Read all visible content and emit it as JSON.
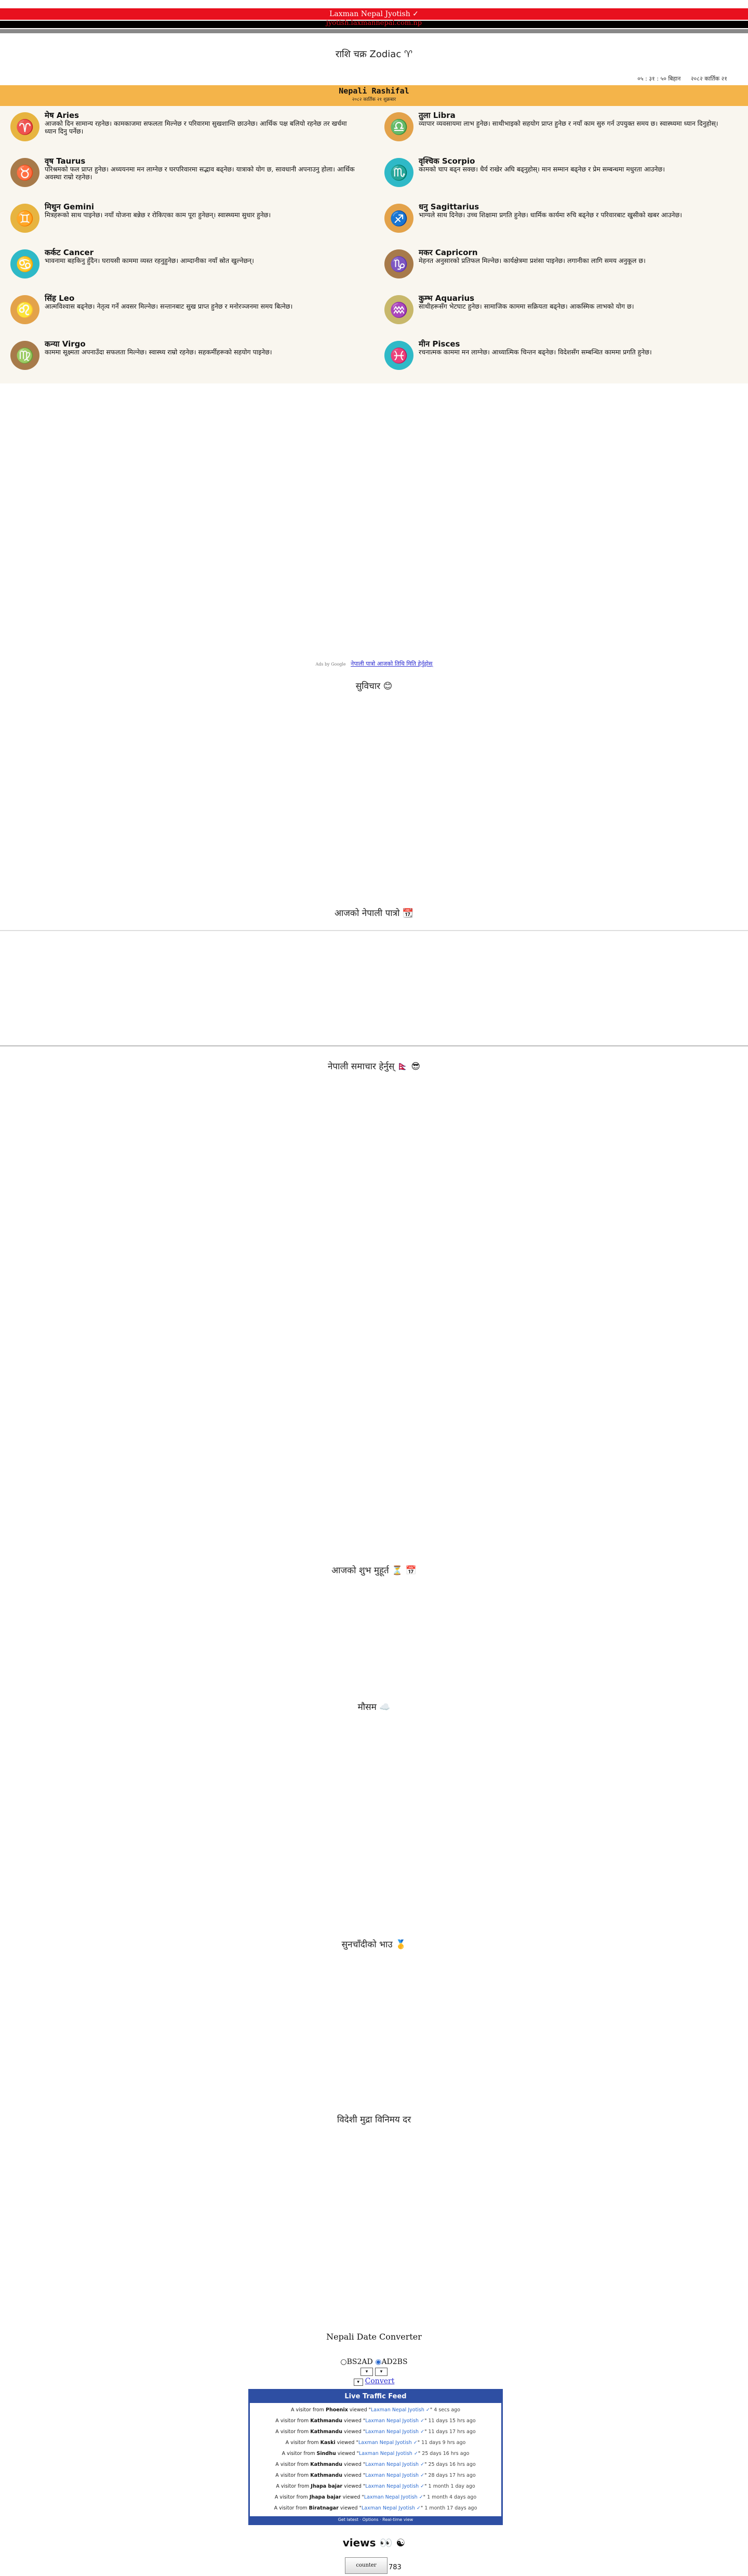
{
  "header": {
    "site_title": "Laxman Nepal Jyotish ✓",
    "site_domain": "jyotish.laxmannepal.com.np"
  },
  "zodiac_heading": "राशि चक्र Zodiac ♈",
  "date_line": {
    "time": "०५ : ३१ : ५० बिहान",
    "date": "२०८२ कार्तिक २१"
  },
  "rashifal": {
    "title": "Nepali Rashifal",
    "subtitle": "२०८२ कार्तिक २१ शुक्रबार",
    "signs": [
      {
        "name": "मेष Aries",
        "icon": "aries-icon",
        "glyph": "♈",
        "text": "आजको दिन सामान्य रहनेछ। कामकाजमा सफलता मिल्नेछ र परिवारमा सुखशान्ति छाउनेछ। आर्थिक पक्ष बलियो रहनेछ तर खर्चमा ध्यान दिनु पर्नेछ।"
      },
      {
        "name": "तुला Libra",
        "icon": "libra-icon",
        "glyph": "♎",
        "text": "व्यापार व्यवसायमा लाभ हुनेछ। साथीभाइको सहयोग प्राप्त हुनेछ र नयाँ काम सुरु गर्न उपयुक्त समय छ। स्वास्थ्यमा ध्यान दिनुहोस्।"
      },
      {
        "name": "वृष Taurus",
        "icon": "taurus-icon",
        "glyph": "♉",
        "text": "परिश्रमको फल प्राप्त हुनेछ। अध्ययनमा मन लाग्नेछ र घरपरिवारमा सद्भाव बढ्नेछ। यात्राको योग छ, सावधानी अपनाउनु होला। आर्थिक अवस्था राम्रो रहनेछ।"
      },
      {
        "name": "वृश्चिक Scorpio",
        "icon": "scorpio-icon",
        "glyph": "♏",
        "text": "कामको चाप बढ्न सक्छ। धैर्य राखेर अघि बढ्नुहोस्। मान सम्मान बढ्नेछ र प्रेम सम्बन्धमा मधुरता आउनेछ।"
      },
      {
        "name": "मिथुन Gemini",
        "icon": "gemini-icon",
        "glyph": "♊",
        "text": "मित्रहरूको साथ पाइनेछ। नयाँ योजना बन्नेछ र रोकिएका काम पूरा हुनेछन्। स्वास्थ्यमा सुधार हुनेछ।"
      },
      {
        "name": "धनु Sagittarius",
        "icon": "sagittarius-icon",
        "glyph": "♐",
        "text": "भाग्यले साथ दिनेछ। उच्च शिक्षामा प्रगति हुनेछ। धार्मिक कार्यमा रुचि बढ्नेछ र परिवारबाट खुसीको खबर आउनेछ।"
      },
      {
        "name": "कर्कट Cancer",
        "icon": "cancer-icon",
        "glyph": "♋",
        "text": "भावनामा बहकिनु हुँदैन। घरायसी काममा व्यस्त रहनुहुनेछ। आम्दानीका नयाँ स्रोत खुल्नेछन्।"
      },
      {
        "name": "मकर Capricorn",
        "icon": "capricorn-icon",
        "glyph": "♑",
        "text": "मेहनत अनुसारको प्रतिफल मिल्नेछ। कार्यक्षेत्रमा प्रशंसा पाइनेछ। लगानीका लागि समय अनुकूल छ।"
      },
      {
        "name": "सिंह Leo",
        "icon": "leo-icon",
        "glyph": "♌",
        "text": "आत्मविश्वास बढ्नेछ। नेतृत्व गर्ने अवसर मिल्नेछ। सन्तानबाट सुख प्राप्त हुनेछ र मनोरञ्जनमा समय बित्नेछ।"
      },
      {
        "name": "कुम्भ Aquarius",
        "icon": "aquarius-icon",
        "glyph": "♒",
        "text": "साथीहरूसँग भेटघाट हुनेछ। सामाजिक काममा सक्रियता बढ्नेछ। आकस्मिक लाभको योग छ।"
      },
      {
        "name": "कन्या Virgo",
        "icon": "virgo-icon",
        "glyph": "♍",
        "text": "काममा सूक्ष्मता अपनाउँदा सफलता मिल्नेछ। स्वास्थ्य राम्रो रहनेछ। सहकर्मीहरूको सहयोग पाइनेछ।"
      },
      {
        "name": "मीन Pisces",
        "icon": "pisces-icon",
        "glyph": "♓",
        "text": "रचनात्मक काममा मन लाग्नेछ। आध्यात्मिक चिन्तन बढ्नेछ। विदेशसँग सम्बन्धित काममा प्रगति हुनेछ।"
      }
    ]
  },
  "ad_link": {
    "label": "Ads by Google",
    "text": "नेपाली पात्रो आजको तिथि मिति हेर्नुहोस्"
  },
  "sections": {
    "s1": "सुविचार 😊",
    "s2": "आजको नेपाली पात्रो 📆",
    "s3": "नेपाली समाचार हेर्नुस् 🇳🇵 😎",
    "s4": "आजको शुभ मुहूर्त ⏳ 📅",
    "s5": "मौसम ☁️",
    "s6": "सुनचाँदीको भाउ 🥇",
    "s7": "विदेशी मुद्रा विनिमय दर"
  },
  "converter": {
    "title": "Nepali Date Converter",
    "opt_bs": "BS2AD",
    "opt_ad": "AD2BS",
    "button": "Convert"
  },
  "feed": {
    "title": "Live Traffic Feed",
    "rows": [
      {
        "city": "Phoenix",
        "page": "Laxman Nepal Jyotish ✓",
        "time": "4 secs ago"
      },
      {
        "city": "Kathmandu",
        "page": "Laxman Nepal Jyotish ✓",
        "time": "11 days 15 hrs ago"
      },
      {
        "city": "Kathmandu",
        "page": "Laxman Nepal Jyotish ✓",
        "time": "11 days 17 hrs ago"
      },
      {
        "city": "Kaski",
        "page": "Laxman Nepal Jyotish ✓",
        "time": "11 days 9 hrs ago"
      },
      {
        "city": "Sindhu",
        "page": "Laxman Nepal Jyotish ✓",
        "time": "25 days 16 hrs ago"
      },
      {
        "city": "Kathmandu",
        "page": "Laxman Nepal Jyotish ✓",
        "time": "25 days 16 hrs ago"
      },
      {
        "city": "Kathmandu",
        "page": "Laxman Nepal Jyotish ✓",
        "time": "28 days 17 hrs ago"
      },
      {
        "city": "Jhapa bajar",
        "page": "Laxman Nepal Jyotish ✓",
        "time": "1 month 1 day ago"
      },
      {
        "city": "Jhapa bajar",
        "page": "Laxman Nepal Jyotish ✓",
        "time": "1 month 4 days ago"
      },
      {
        "city": "Biratnagar",
        "page": "Laxman Nepal Jyotish ✓",
        "time": "1 month 17 days ago"
      }
    ],
    "visitor_prefix": "A visitor from",
    "viewed": "viewed",
    "footer": "Get latest · Options · Real-time view"
  },
  "views": {
    "title": "views 👀 ☯",
    "counter_img": "counter",
    "count": "783"
  }
}
